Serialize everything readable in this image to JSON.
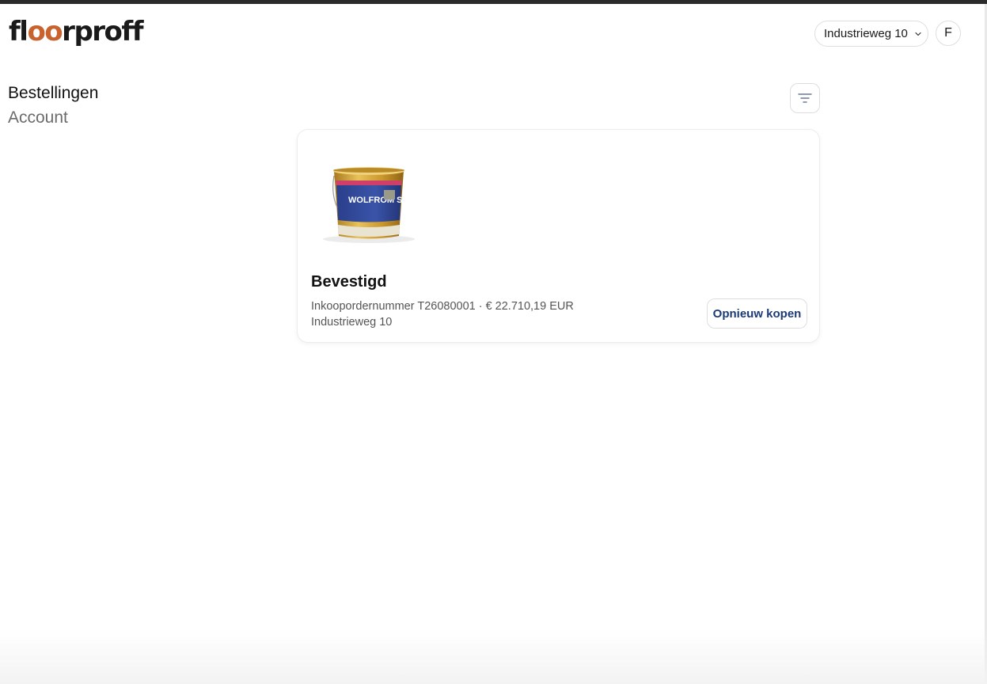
{
  "header": {
    "logo_text_pre": "fl",
    "logo_text_oo": "oo",
    "logo_text_post": "rproff",
    "location_label": "Industrieweg 10",
    "avatar_initial": "F"
  },
  "nav": {
    "items": [
      {
        "label": "Bestellingen",
        "active": true
      },
      {
        "label": "Account",
        "active": false
      }
    ]
  },
  "orders": [
    {
      "status": "Bevestigd",
      "order_line": "Inkoopordernummer T26080001 · € 22.710,19 EUR",
      "address": "Industrieweg 10",
      "rebuy_label": "Opnieuw kopen",
      "product_label": "WOLFROM S"
    }
  ],
  "colors": {
    "brand_accent": "#c8632f",
    "button_text": "#1b3a78"
  },
  "icons": {
    "filter": "filter-icon",
    "chevron": "chevron-down-icon"
  }
}
